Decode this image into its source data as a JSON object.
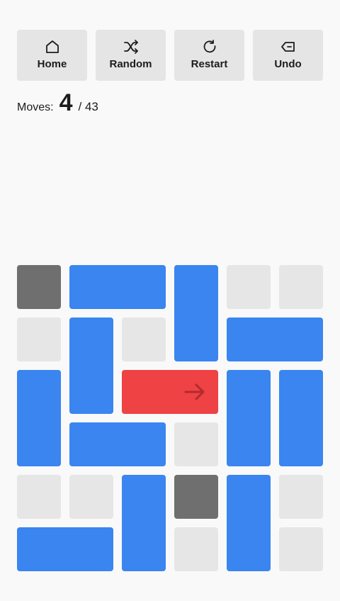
{
  "toolbar": {
    "home_label": "Home",
    "random_label": "Random",
    "restart_label": "Restart",
    "undo_label": "Undo"
  },
  "status": {
    "moves_label": "Moves:",
    "moves_count": "4",
    "moves_target": "/ 43"
  },
  "colors": {
    "background": "#f9f9f9",
    "empty_cell": "#e6e6e6",
    "wall": "#6f6f6f",
    "block": "#3a85f0",
    "target": "#ee4245",
    "button": "#e5e5e5"
  },
  "icons": {
    "home": "home-icon",
    "random": "shuffle-icon",
    "restart": "restart-icon",
    "undo": "backspace-icon",
    "target": "arrow-right-icon"
  },
  "board": {
    "rows": 6,
    "cols": 6,
    "walls": [
      [
        0,
        0
      ],
      [
        4,
        3
      ]
    ],
    "target": {
      "row": 2,
      "col": 2,
      "length": 2,
      "orientation": "horizontal"
    },
    "blocks": [
      {
        "row": 0,
        "col": 1,
        "length": 2,
        "orientation": "horizontal"
      },
      {
        "row": 0,
        "col": 3,
        "length": 2,
        "orientation": "vertical"
      },
      {
        "row": 1,
        "col": 1,
        "length": 2,
        "orientation": "vertical"
      },
      {
        "row": 1,
        "col": 4,
        "length": 2,
        "orientation": "horizontal"
      },
      {
        "row": 2,
        "col": 0,
        "length": 2,
        "orientation": "vertical"
      },
      {
        "row": 2,
        "col": 4,
        "length": 2,
        "orientation": "vertical"
      },
      {
        "row": 2,
        "col": 5,
        "length": 2,
        "orientation": "vertical"
      },
      {
        "row": 3,
        "col": 1,
        "length": 2,
        "orientation": "horizontal"
      },
      {
        "row": 4,
        "col": 2,
        "length": 2,
        "orientation": "vertical"
      },
      {
        "row": 4,
        "col": 4,
        "length": 2,
        "orientation": "vertical"
      },
      {
        "row": 5,
        "col": 0,
        "length": 2,
        "orientation": "horizontal"
      }
    ]
  }
}
